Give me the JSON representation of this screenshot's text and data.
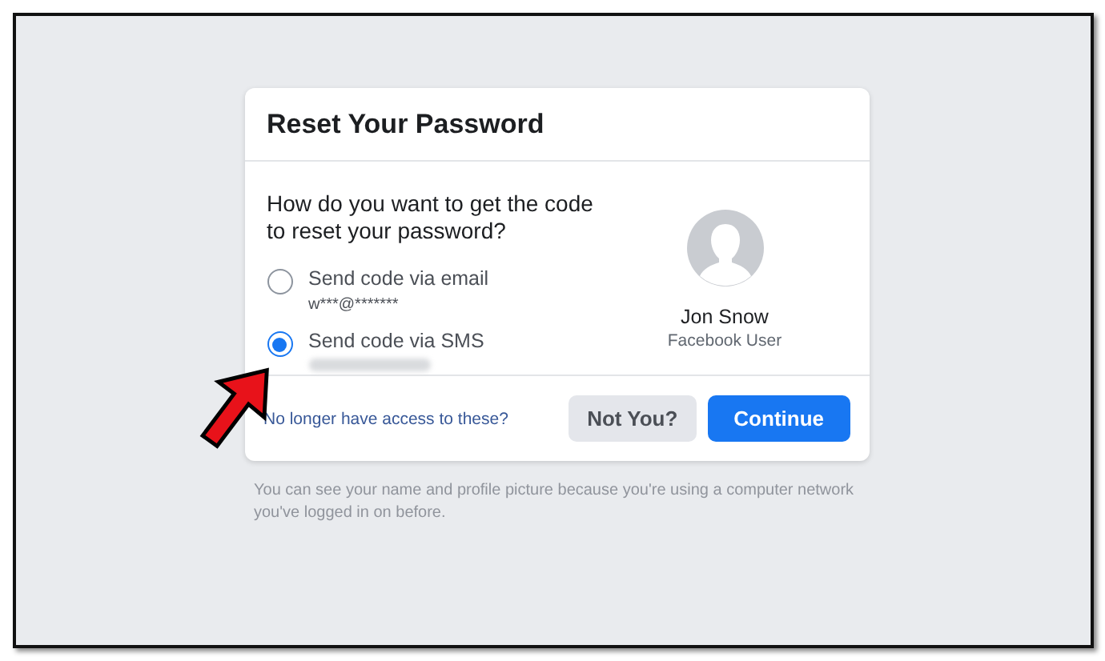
{
  "dialog": {
    "title": "Reset Your Password",
    "question": "How do you want to get the code to reset your password?",
    "options": [
      {
        "label": "Send code via email",
        "detail": "w***@*******",
        "detail_blurred": false,
        "selected": false
      },
      {
        "label": "Send code via SMS",
        "detail_blurred": true,
        "selected": true
      }
    ],
    "profile": {
      "name": "Jon Snow",
      "subtitle": "Facebook User"
    },
    "link": "No longer have access to these?",
    "buttons": [
      {
        "label": "Not You?",
        "kind": "secondary"
      },
      {
        "label": "Continue",
        "kind": "primary"
      }
    ]
  },
  "footnote": "You can see your name and profile picture because you're using a computer network you've logged in on before."
}
